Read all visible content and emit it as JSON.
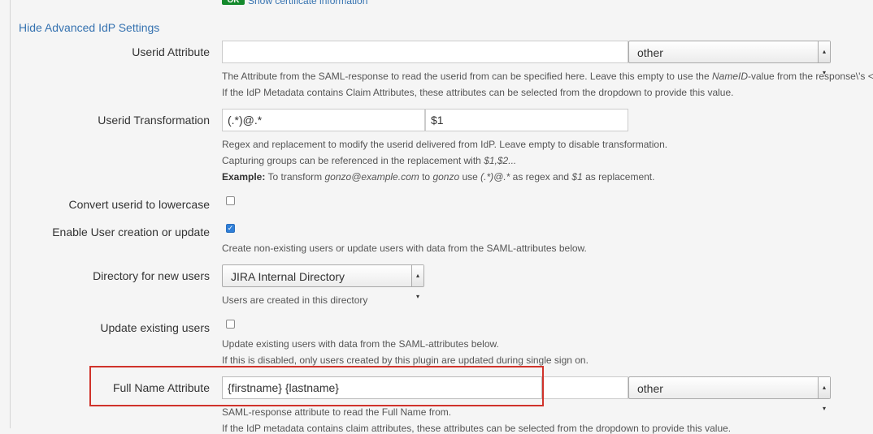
{
  "top": {
    "badge": "OK",
    "cert_link": "Show certificate information"
  },
  "toggle_link": "Hide Advanced IdP Settings",
  "userid_attr": {
    "label": "Userid Attribute",
    "value": "",
    "select": "other",
    "desc1_pre": "The Attribute from the SAML-response to read the userid from can be specified here. Leave this empty to use the ",
    "desc1_em": "NameID",
    "desc1_post": "-value from the response\\'s <",
    "desc2": "If the IdP Metadata contains Claim Attributes, these attributes can be selected from the dropdown to provide this value."
  },
  "userid_transform": {
    "label": "Userid Transformation",
    "regex": "(.*)@.*",
    "replacement": "$1",
    "desc1": "Regex and replacement to modify the userid delivered from IdP. Leave empty to disable transformation.",
    "desc2_pre": "Capturing groups can be referenced in the replacement with ",
    "desc2_em": "$1,$2...",
    "example_label": "Example:",
    "example_a": " To transform ",
    "example_b": "gonzo@example.com",
    "example_c": " to ",
    "example_d": "gonzo",
    "example_e": " use ",
    "example_f": "(.*)@.*",
    "example_g": " as regex and ",
    "example_h": "$1",
    "example_i": " as replacement."
  },
  "lowercase": {
    "label": "Convert userid to lowercase",
    "checked": false
  },
  "user_creation": {
    "label": "Enable User creation or update",
    "checked": true,
    "desc": "Create non-existing users or update users with data from the SAML-attributes below."
  },
  "directory": {
    "label": "Directory for new users",
    "select": "JIRA Internal Directory",
    "desc": "Users are created in this directory"
  },
  "update_users": {
    "label": "Update existing users",
    "checked": false,
    "desc1": "Update existing users with data from the SAML-attributes below.",
    "desc2": "If this is disabled, only users created by this plugin are updated during single sign on."
  },
  "full_name": {
    "label": "Full Name Attribute",
    "value": "{firstname} {lastname}",
    "select": "other",
    "desc1": "SAML-response attribute to read the Full Name from.",
    "desc2": "If the IdP metadata contains claim attributes, these attributes can be selected from the dropdown to provide this value."
  },
  "colors": {
    "link": "#3572b0",
    "highlight": "#d0332b",
    "ok_badge": "#14892c"
  }
}
